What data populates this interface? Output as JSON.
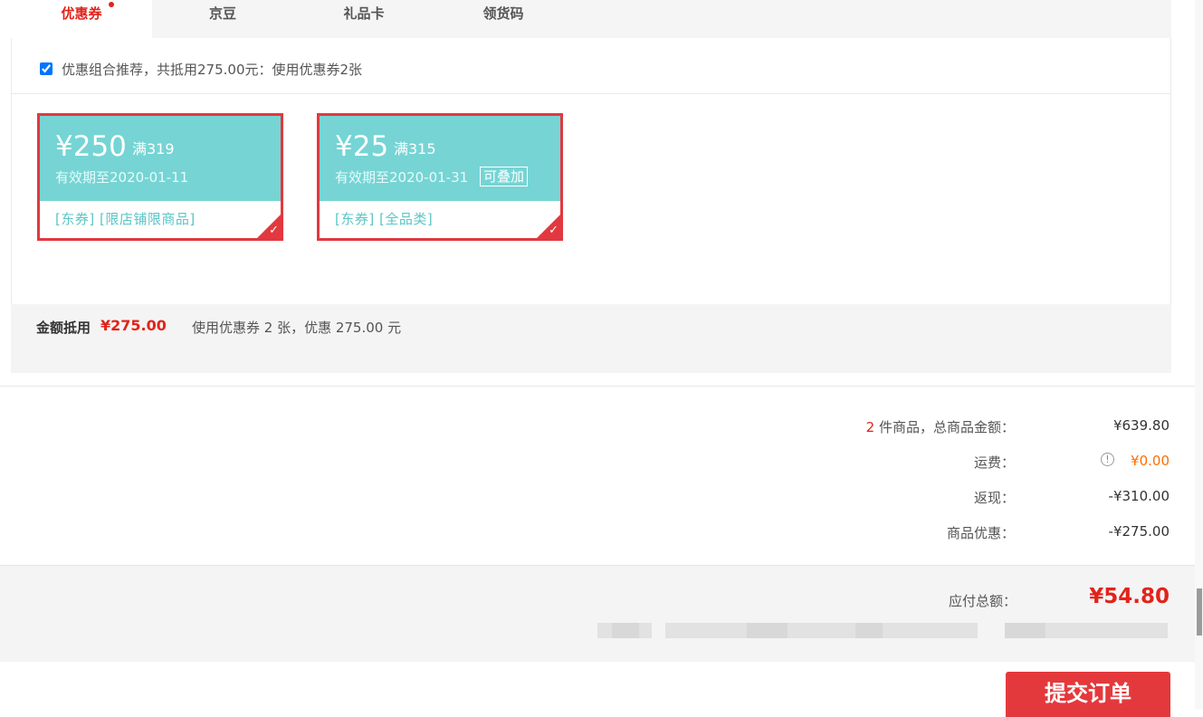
{
  "tabs": [
    {
      "label": "优惠券",
      "active": true
    },
    {
      "label": "京豆",
      "active": false
    },
    {
      "label": "礼品卡",
      "active": false
    },
    {
      "label": "领货码",
      "active": false
    }
  ],
  "recommend": {
    "checked": true,
    "text": "优惠组合推荐，共抵用275.00元：使用优惠券2张"
  },
  "coupons": [
    {
      "amount": "¥250",
      "condition": "满319",
      "valid": "有效期至2020-01-11",
      "stackable": "",
      "tags": "[东券] [限店铺限商品]",
      "selected": true
    },
    {
      "amount": "¥25",
      "condition": "满315",
      "valid": "有效期至2020-01-31",
      "stackable": "可叠加",
      "tags": "[东券] [全品类]",
      "selected": true
    }
  ],
  "coupon_summary": {
    "label": "金额抵用",
    "amount": "¥275.00",
    "description": "使用优惠券 2 张，优惠 275.00 元"
  },
  "totals": {
    "items_count": "2",
    "items_label": " 件商品，总商品金额：",
    "items_value": "¥639.80",
    "shipping_label": "运费：",
    "shipping_value": "¥0.00",
    "cashback_label": "返现：",
    "cashback_value": "-¥310.00",
    "discount_label": "商品优惠：",
    "discount_value": "-¥275.00"
  },
  "payable": {
    "label": "应付总额：",
    "amount": "¥54.80"
  },
  "submit_label": "提交订单",
  "colors": {
    "accent_red": "#e2231a",
    "coupon_teal": "#76d4d4",
    "coupon_border": "#e2383f",
    "shipping_orange": "#ff6d00"
  },
  "icons": [
    "checkbox",
    "check-mark-icon",
    "info-icon"
  ]
}
